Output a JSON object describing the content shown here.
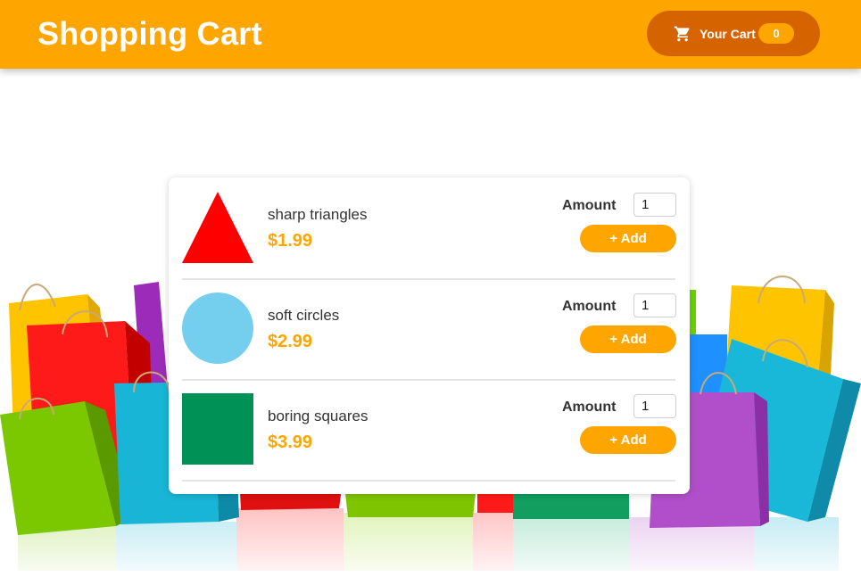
{
  "header": {
    "title": "Shopping Cart",
    "cart_label": "Your Cart",
    "cart_count": "0",
    "color": "#ffa500",
    "cart_button_color": "#d46300"
  },
  "products": [
    {
      "name": "sharp triangles",
      "price": "$1.99",
      "amount_label": "Amount",
      "amount": "1",
      "add_label": "+ Add",
      "shape": "triangle",
      "color": "#ff0000"
    },
    {
      "name": "soft circles",
      "price": "$2.99",
      "amount_label": "Amount",
      "amount": "1",
      "add_label": "+ Add",
      "shape": "circle",
      "color": "#74cfee"
    },
    {
      "name": "boring squares",
      "price": "$3.99",
      "amount_label": "Amount",
      "amount": "1",
      "add_label": "+ Add",
      "shape": "square",
      "color": "#009157"
    }
  ],
  "icons": {
    "cart": "shopping-cart-icon"
  },
  "background": {
    "image": "shopping-bags-illustration"
  }
}
